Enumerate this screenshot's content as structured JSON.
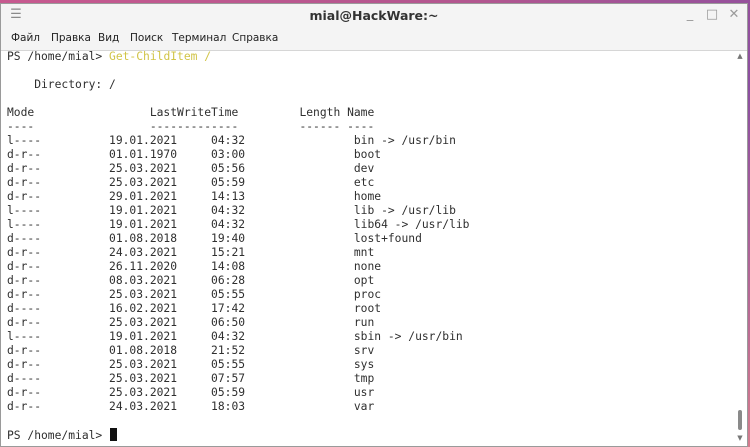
{
  "window": {
    "title": "mial@HackWare:~",
    "minimize_glyph": "_",
    "maximize_glyph": "□",
    "close_glyph": "✕"
  },
  "menu": {
    "items": [
      "Файл",
      "Правка",
      "Вид",
      "Поиск",
      "Терминал",
      "Справка"
    ]
  },
  "terminal": {
    "prompt": "PS /home/mial> ",
    "command": "Get-ChildItem /",
    "directory_line": "    Directory: /",
    "header": "Mode                 LastWriteTime         Length Name",
    "underline": "----                 -------------         ------ ----",
    "rows": [
      "l----          19.01.2021     04:32                bin -> /usr/bin",
      "d-r--          01.01.1970     03:00                boot",
      "d-r--          25.03.2021     05:56                dev",
      "d-r--          25.03.2021     05:59                etc",
      "d-r--          29.01.2021     14:13                home",
      "l----          19.01.2021     04:32                lib -> /usr/lib",
      "l----          19.01.2021     04:32                lib64 -> /usr/lib",
      "d----          01.08.2018     19:40                lost+found",
      "d-r--          24.03.2021     15:21                mnt",
      "d-r--          26.11.2020     14:08                none",
      "d-r--          08.03.2021     06:28                opt",
      "d-r--          25.03.2021     05:55                proc",
      "d----          16.02.2021     17:42                root",
      "d-r--          25.03.2021     06:50                run",
      "l----          19.01.2021     04:32                sbin -> /usr/bin",
      "d-r--          01.08.2018     21:52                srv",
      "d-r--          25.03.2021     05:55                sys",
      "d----          25.03.2021     07:57                tmp",
      "d-r--          25.03.2021     05:59                usr",
      "d-r--          24.03.2021     18:03                var"
    ],
    "final_prompt": "PS /home/mial> "
  },
  "icons": {
    "app": "terminal-icon",
    "scroll_up": "▲",
    "scroll_down": "▼"
  }
}
